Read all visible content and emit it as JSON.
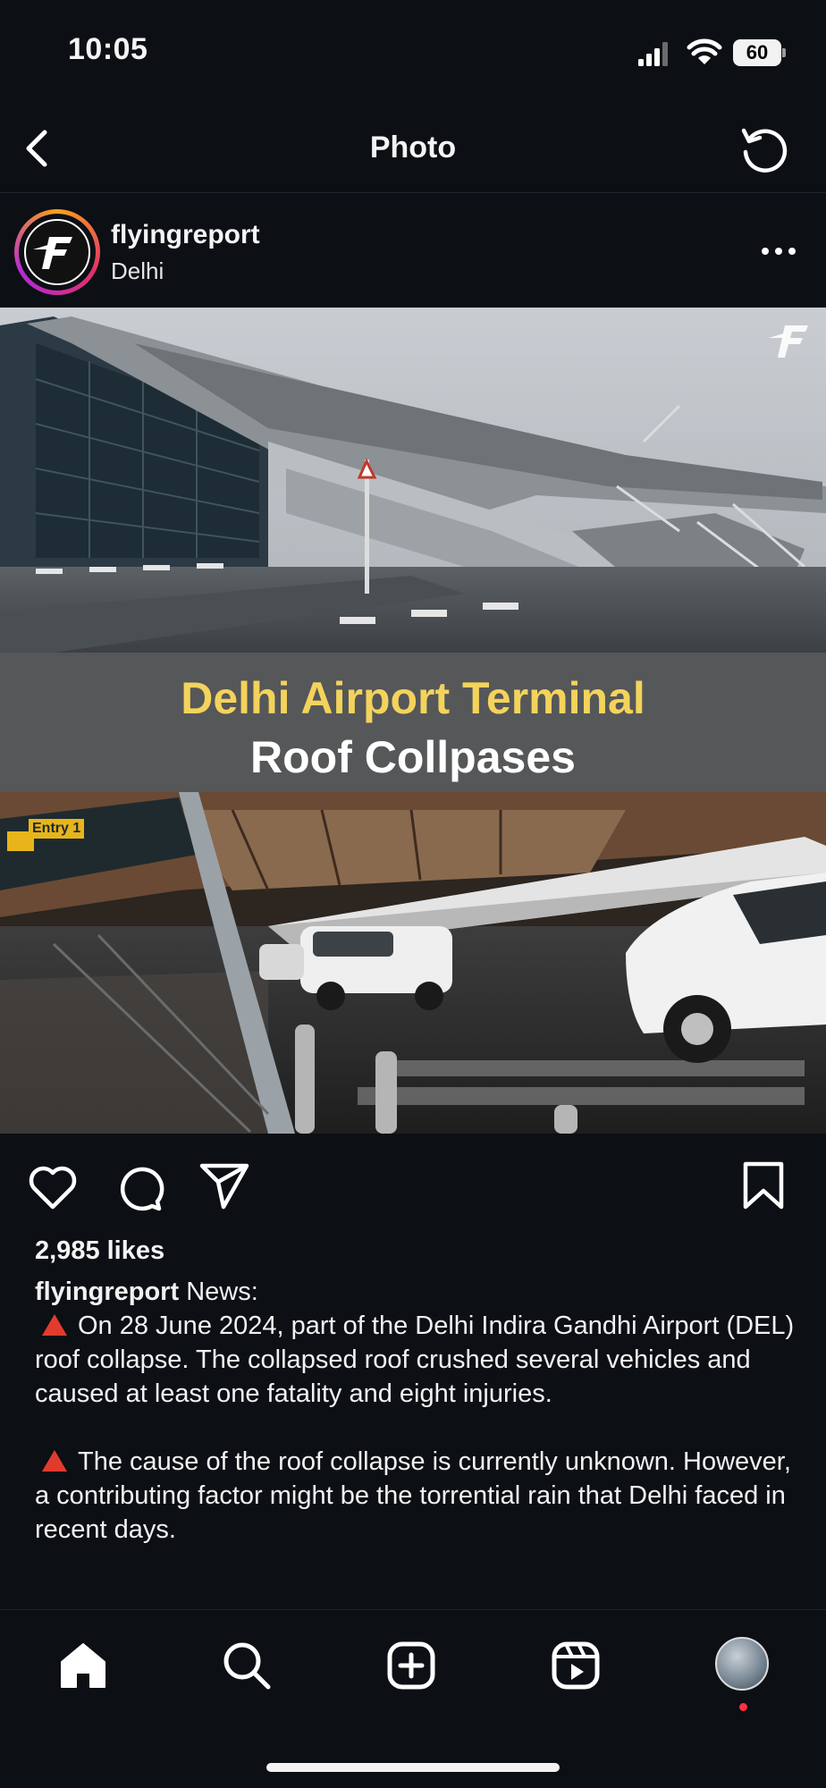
{
  "status_bar": {
    "time": "10:05",
    "battery": "60"
  },
  "header": {
    "title": "Photo"
  },
  "post": {
    "username": "flyingreport",
    "location": "Delhi"
  },
  "media": {
    "headline_line1": "Delhi Airport Terminal",
    "headline_line2": "Roof Collpases",
    "entry_sign": "Entry 1"
  },
  "engagement": {
    "likes": "2,985 likes"
  },
  "caption": {
    "username": "flyingreport",
    "intro": "News:",
    "paragraph1": "On 28 June 2024, part of the Delhi Indira Gandhi Airport (DEL) roof collapse. The collapsed roof crushed several vehicles and caused at least one fatality and eight injuries.",
    "paragraph2": "The cause of the roof collapse is currently unknown. However, a contributing factor might be the torrential rain that Delhi faced in recent days."
  },
  "colors": {
    "background": "#0c0f14",
    "headline_yellow": "#f3d35b",
    "alert_red": "#e23b2e",
    "notification": "#ff3040"
  },
  "icons": [
    "back-icon",
    "refresh-icon",
    "more-icon",
    "heart-icon",
    "comment-icon",
    "send-icon",
    "bookmark-icon",
    "home-icon",
    "search-icon",
    "create-icon",
    "reels-icon",
    "profile-icon"
  ]
}
